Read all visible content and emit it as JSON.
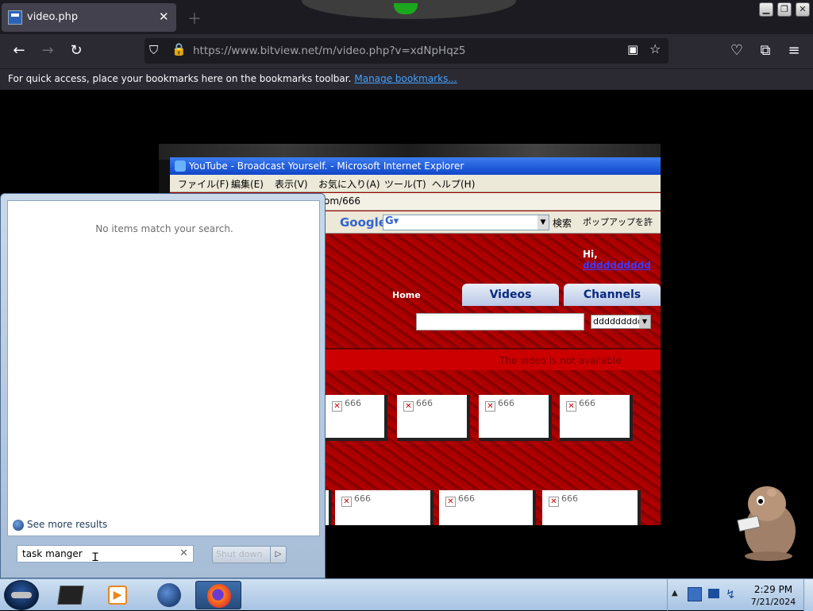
{
  "browser": {
    "tab": {
      "title": "video.php"
    },
    "url": "https://www.bitview.net/m/video.php?v=xdNpHqz5",
    "bookmarks_bar": {
      "message": "For quick access, place your bookmarks here on the bookmarks toolbar.",
      "link": "Manage bookmarks..."
    }
  },
  "video": {
    "ie_title": "YouTube - Broadcast Yourself. - Microsoft Internet Explorer",
    "ie_menu": [
      "ファイル(F)",
      "編集(E)",
      "表示(V)",
      "お気に入り(A)",
      "ツール(T)",
      "ヘルプ(H)"
    ],
    "ie_address": "om/666",
    "google_logo": "Google",
    "google_go": "検索",
    "popup_button": "ポップアップを許",
    "yt_hi_prefix": "Hi,",
    "yt_hi_user": "dddddddddd",
    "yt_tab_home": "Home",
    "yt_tab_videos": "Videos",
    "yt_tab_channels": "Channels",
    "yt_select_value": "ddddddddd",
    "yt_notice": "The video is not available",
    "thumb_label": "666"
  },
  "start_menu": {
    "no_items": "No items match your search.",
    "see_more": "See more results",
    "search_value": "task manger",
    "shutdown_label": "Shut down"
  },
  "taskbar": {
    "time": "2:29 PM",
    "date": "7/21/2024"
  },
  "colors": {
    "firefox_dark": "#1c1b22",
    "firefox_toolbar": "#2b2a33",
    "link_blue": "#45a1ff",
    "yt_red": "#a10000",
    "taskbar_blue": "#a8c3e2"
  }
}
